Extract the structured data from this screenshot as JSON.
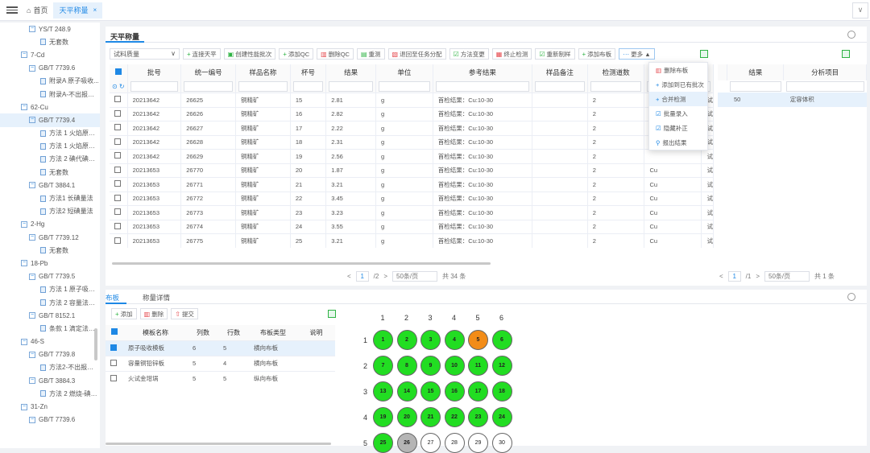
{
  "topbar": {
    "home_tab": "首页",
    "active_tab": "天平称量",
    "close": "×",
    "expand": "∨"
  },
  "tree": [
    {
      "level": 2,
      "kind": "folder",
      "label": "YS/T 248.9"
    },
    {
      "level": 3,
      "kind": "doc",
      "label": "无套数"
    },
    {
      "level": 1,
      "kind": "folder",
      "label": "7-Cd"
    },
    {
      "level": 2,
      "kind": "folder",
      "label": "GB/T 7739.6"
    },
    {
      "level": 3,
      "kind": "doc",
      "label": "附录A 原子吸收..."
    },
    {
      "level": 3,
      "kind": "doc",
      "label": "附录A-不出报告 ..."
    },
    {
      "level": 1,
      "kind": "folder",
      "label": "62-Cu"
    },
    {
      "level": 2,
      "kind": "folder",
      "label": "GB/T 7739.4",
      "selected": true
    },
    {
      "level": 3,
      "kind": "doc",
      "label": "方法 1 火焰原子..."
    },
    {
      "level": 3,
      "kind": "doc",
      "label": "方法 1 火焰原子..."
    },
    {
      "level": 3,
      "kind": "doc",
      "label": "方法 2 碘代碘量..."
    },
    {
      "level": 3,
      "kind": "doc",
      "label": "无套数"
    },
    {
      "level": 2,
      "kind": "folder",
      "label": "GB/T 3884.1"
    },
    {
      "level": 3,
      "kind": "doc",
      "label": "方法1 长碘量法"
    },
    {
      "level": 3,
      "kind": "doc",
      "label": "方法2 短碘量法"
    },
    {
      "level": 1,
      "kind": "folder",
      "label": "2-Hg"
    },
    {
      "level": 2,
      "kind": "folder",
      "label": "GB/T 7739.12"
    },
    {
      "level": 3,
      "kind": "doc",
      "label": "无套数"
    },
    {
      "level": 1,
      "kind": "folder",
      "label": "18-Pb"
    },
    {
      "level": 2,
      "kind": "folder",
      "label": "GB/T 7739.5"
    },
    {
      "level": 3,
      "kind": "doc",
      "label": "方法 1 原子吸收..."
    },
    {
      "level": 3,
      "kind": "doc",
      "label": "方法 2 容量法测..."
    },
    {
      "level": 2,
      "kind": "folder",
      "label": "GB/T 8152.1"
    },
    {
      "level": 3,
      "kind": "doc",
      "label": "条款 1 滴定法测..."
    },
    {
      "level": 1,
      "kind": "folder",
      "label": "46-S"
    },
    {
      "level": 2,
      "kind": "folder",
      "label": "GB/T 7739.8"
    },
    {
      "level": 3,
      "kind": "doc",
      "label": "方法2-不出报告 ..."
    },
    {
      "level": 2,
      "kind": "folder",
      "label": "GB/T 3884.3"
    },
    {
      "level": 3,
      "kind": "doc",
      "label": "方法 2 燃烧-碘滴..."
    },
    {
      "level": 1,
      "kind": "folder",
      "label": "31-Zn"
    },
    {
      "level": 2,
      "kind": "folder",
      "label": "GB/T 7739.6"
    }
  ],
  "main": {
    "title": "天平称量",
    "select_value": "试料质量",
    "buttons": [
      {
        "icon": "+",
        "label": "连接天平",
        "color": "g"
      },
      {
        "icon": "▣",
        "label": "创建性能批次",
        "color": "g"
      },
      {
        "icon": "+",
        "label": "添加QC",
        "color": "g"
      },
      {
        "icon": "▥",
        "label": "删除QC",
        "color": "r"
      },
      {
        "icon": "▤",
        "label": "重测",
        "color": "g"
      },
      {
        "icon": "▧",
        "label": "退回至任务分配",
        "color": "r"
      },
      {
        "icon": "☑",
        "label": "方法变更",
        "color": "g"
      },
      {
        "icon": "▦",
        "label": "终止检测",
        "color": "r"
      },
      {
        "icon": "☑",
        "label": "重新制样",
        "color": "g"
      },
      {
        "icon": "+",
        "label": "添加布板",
        "color": "g"
      },
      {
        "icon": "···",
        "label": "更多 ▲",
        "color": "b"
      }
    ],
    "columns": [
      "批号",
      "统一编号",
      "样品名称",
      "杯号",
      "结果",
      "单位",
      "参考结果",
      "样品备注",
      "检测道数"
    ],
    "rows": [
      [
        "20213642",
        "26625",
        "铜精矿",
        "15",
        "2.81",
        "g",
        "首检结果：Cu:10-30",
        "",
        "2",
        "",
        "试"
      ],
      [
        "20213642",
        "26626",
        "铜精矿",
        "16",
        "2.82",
        "g",
        "首检结果：Cu:10-30",
        "",
        "2",
        "",
        "试"
      ],
      [
        "20213642",
        "26627",
        "铜精矿",
        "17",
        "2.22",
        "g",
        "首检结果：Cu:10-30",
        "",
        "2",
        "",
        "试"
      ],
      [
        "20213642",
        "26628",
        "铜精矿",
        "18",
        "2.31",
        "g",
        "首检结果：Cu:10-30",
        "",
        "2",
        "",
        "试"
      ],
      [
        "20213642",
        "26629",
        "铜精矿",
        "19",
        "2.56",
        "g",
        "首检结果：Cu:10-30",
        "",
        "2",
        "",
        "试"
      ],
      [
        "20213653",
        "26770",
        "铜精矿",
        "20",
        "1.87",
        "g",
        "首检结果：Cu:10-30",
        "",
        "2",
        "Cu",
        "试"
      ],
      [
        "20213653",
        "26771",
        "铜精矿",
        "21",
        "3.21",
        "g",
        "首检结果：Cu:10-30",
        "",
        "2",
        "Cu",
        "试"
      ],
      [
        "20213653",
        "26772",
        "铜精矿",
        "22",
        "3.45",
        "g",
        "首检结果：Cu:10-30",
        "",
        "2",
        "Cu",
        "试"
      ],
      [
        "20213653",
        "26773",
        "铜精矿",
        "23",
        "3.23",
        "g",
        "首检结果：Cu:10-30",
        "",
        "2",
        "Cu",
        "试"
      ],
      [
        "20213653",
        "26774",
        "铜精矿",
        "24",
        "3.55",
        "g",
        "首检结果：Cu:10-30",
        "",
        "2",
        "Cu",
        "试"
      ],
      [
        "20213653",
        "26775",
        "铜精矿",
        "25",
        "3.21",
        "g",
        "首检结果：Cu:10-30",
        "",
        "2",
        "Cu",
        "试"
      ]
    ],
    "pager": {
      "prev": "<",
      "page": "1",
      "total": "/2",
      "next": ">",
      "size": "50条/页",
      "count": "共 34 条"
    },
    "more_menu": [
      "删除布板",
      "添加到已有批次",
      "合并检测",
      "批量录入",
      "隐藏补正",
      "报出结果"
    ],
    "more_icons": [
      "▥",
      "+",
      "+",
      "☑",
      "☑",
      "⚲"
    ]
  },
  "side": {
    "columns": [
      "结果",
      "分析项目"
    ],
    "rows": [
      [
        "50",
        "定容体积"
      ]
    ],
    "pager": {
      "prev": "<",
      "page": "1",
      "total": "/1",
      "next": ">",
      "size": "50条/页",
      "count": "共 1 条"
    }
  },
  "bottom": {
    "tabs": [
      "布板",
      "称量详情"
    ],
    "buttons": [
      {
        "icon": "+",
        "label": "添加",
        "color": "g"
      },
      {
        "icon": "▥",
        "label": "删除",
        "color": "r"
      },
      {
        "icon": "⇧",
        "label": "提交",
        "color": "r"
      }
    ],
    "columns": [
      "模板名称",
      "列数",
      "行数",
      "布板类型",
      "说明"
    ],
    "rows": [
      [
        "原子吸收模板",
        "6",
        "5",
        "横向布板",
        "",
        true
      ],
      [
        "容量铜铅锌板",
        "5",
        "4",
        "横向布板",
        "",
        false
      ],
      [
        "火试金坩埚",
        "5",
        "5",
        "纵向布板",
        "",
        false
      ]
    ],
    "plate": {
      "cols": [
        "1",
        "2",
        "3",
        "4",
        "5",
        "6"
      ],
      "rows": [
        "1",
        "2",
        "3",
        "4",
        "5"
      ],
      "wells": [
        [
          "1",
          "green"
        ],
        [
          "2",
          "green"
        ],
        [
          "3",
          "green"
        ],
        [
          "4",
          "green"
        ],
        [
          "5",
          "orange"
        ],
        [
          "6",
          "green"
        ],
        [
          "7",
          "green"
        ],
        [
          "8",
          "green"
        ],
        [
          "9",
          "green"
        ],
        [
          "10",
          "green"
        ],
        [
          "11",
          "green"
        ],
        [
          "12",
          "green"
        ],
        [
          "13",
          "green"
        ],
        [
          "14",
          "green"
        ],
        [
          "15",
          "green"
        ],
        [
          "16",
          "green"
        ],
        [
          "17",
          "green"
        ],
        [
          "18",
          "green"
        ],
        [
          "19",
          "green"
        ],
        [
          "20",
          "green"
        ],
        [
          "21",
          "green"
        ],
        [
          "22",
          "green"
        ],
        [
          "23",
          "green"
        ],
        [
          "24",
          "green"
        ],
        [
          "25",
          "green"
        ],
        [
          "26",
          "gray"
        ],
        [
          "27",
          "empty"
        ],
        [
          "28",
          "empty"
        ],
        [
          "29",
          "empty"
        ],
        [
          "30",
          "empty"
        ]
      ]
    }
  }
}
